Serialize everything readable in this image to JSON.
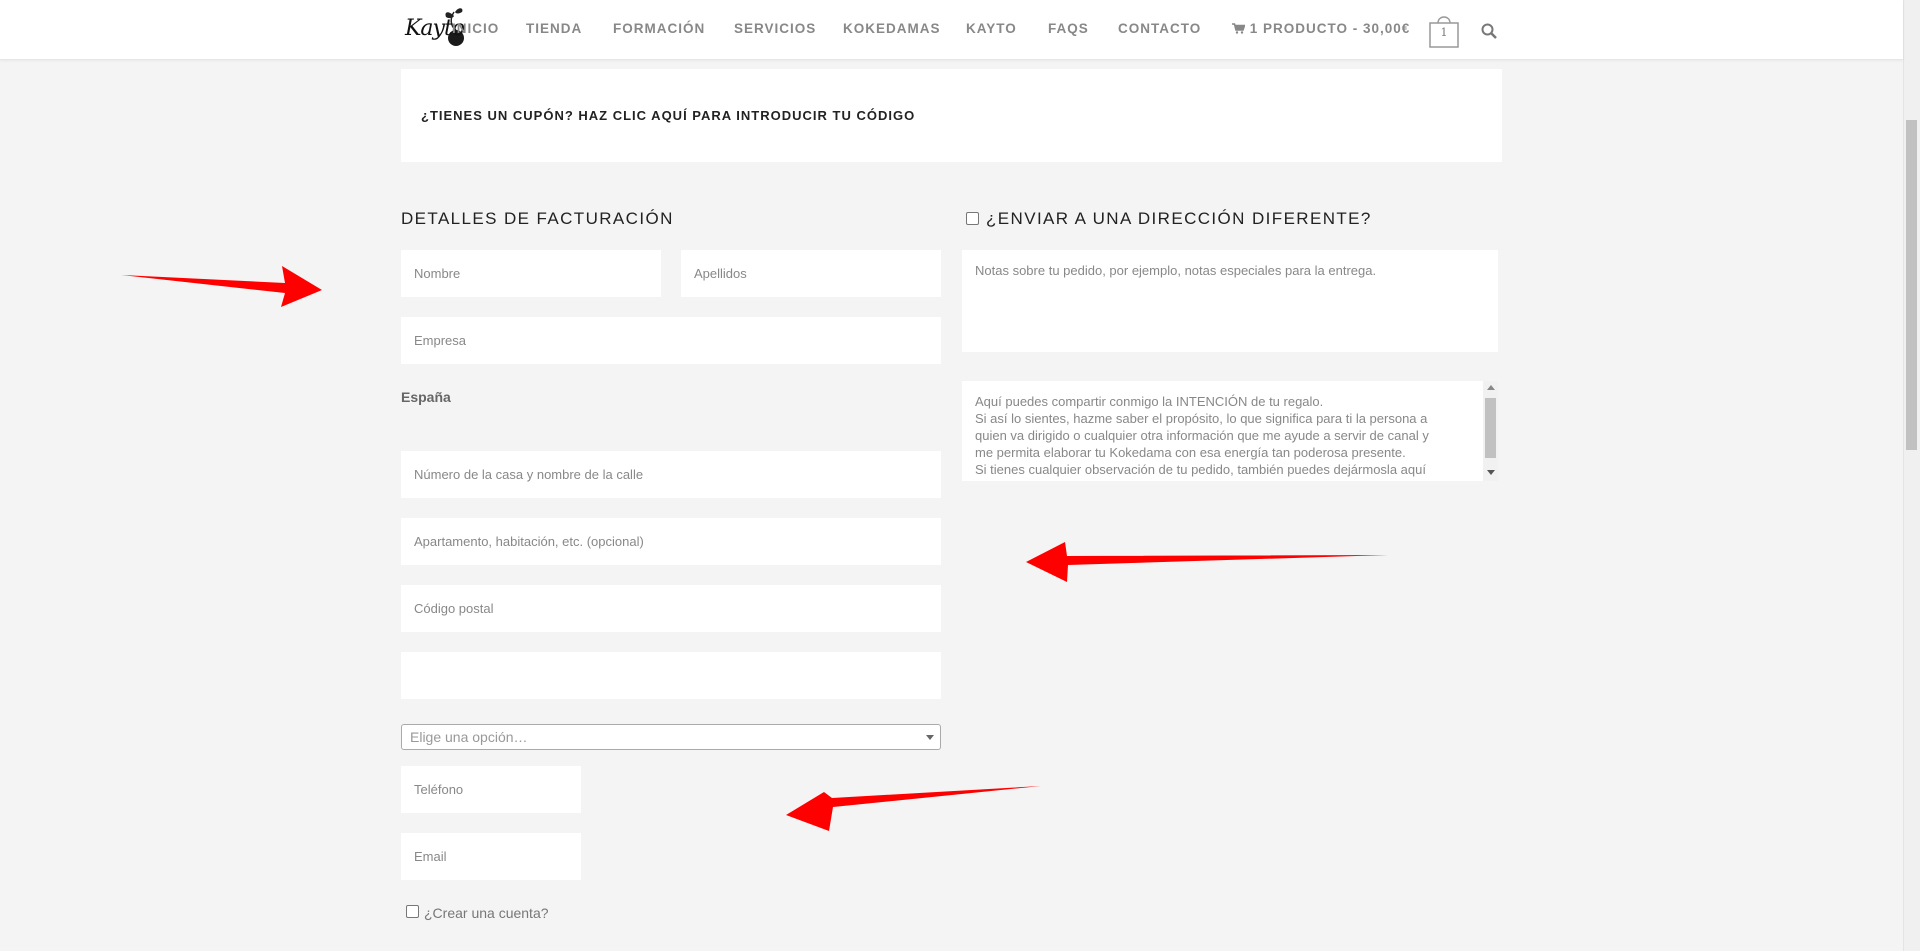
{
  "header": {
    "logo_text": "Kayto",
    "nav": [
      "INICIO",
      "TIENDA",
      "FORMACIÓN",
      "SERVICIOS",
      "KOKEDAMAS",
      "KAYTO",
      "FAQS",
      "CONTACTO"
    ],
    "cart_label": "1 PRODUCTO - 30,00€",
    "bag_count": "1"
  },
  "coupon": {
    "text": "¿TIENES UN CUPÓN? HAZ CLIC AQUÍ PARA INTRODUCIR TU CÓDIGO"
  },
  "billing": {
    "title": "DETALLES DE FACTURACIÓN",
    "first_name_placeholder": "Nombre",
    "last_name_placeholder": "Apellidos",
    "company_placeholder": "Empresa",
    "country": "España",
    "address1_placeholder": "Número de la casa y nombre de la calle",
    "address2_placeholder": "Apartamento, habitación, etc. (opcional)",
    "postcode_placeholder": "Código postal",
    "city_value": "",
    "state_select": "Elige una opción…",
    "phone_placeholder": "Teléfono",
    "email_placeholder": "Email",
    "create_account_label": "¿Crear una cuenta?"
  },
  "shipping": {
    "title": "¿ENVIAR A UNA DIRECCIÓN DIFERENTE?",
    "notes_placeholder": "Notas sobre tu pedido, por ejemplo, notas especiales para la entrega.",
    "intention_lines": [
      "Aquí puedes compartir conmigo la INTENCIÓN de tu regalo.",
      "Si así lo sientes, hazme saber el propósito, lo que significa para ti la persona a",
      "quien va dirigido o cualquier otra información que me ayude a servir de canal y",
      "me permita elaborar tu Kokedama con esa energía tan poderosa presente.",
      "Si tienes cualquier observación de tu pedido, también puedes dejármosla aquí"
    ]
  },
  "colors": {
    "annotation_arrow": "#ff0000",
    "background": "#f4f4f4"
  }
}
